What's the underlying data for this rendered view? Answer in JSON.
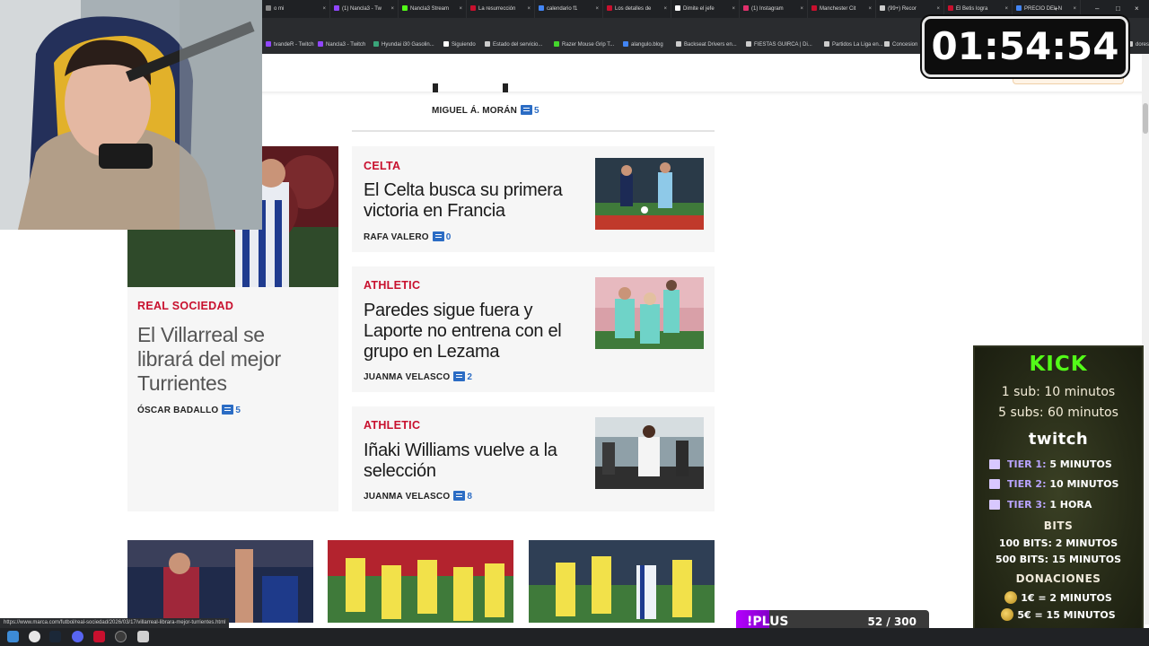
{
  "browser": {
    "tabs": [
      {
        "label": "o mi",
        "color": "#888888"
      },
      {
        "label": "(1) Nancla3 - Tw",
        "color": "#9146ff"
      },
      {
        "label": "Nancla3 Stream",
        "color": "#53fc18"
      },
      {
        "label": "La resurrección",
        "color": "#c8102e"
      },
      {
        "label": "calendario f1",
        "color": "#4285f4"
      },
      {
        "label": "Los detalles de",
        "color": "#c8102e"
      },
      {
        "label": "Dimite el jefe",
        "color": "#ffffff"
      },
      {
        "label": "(1) Instagram",
        "color": "#e1306c"
      },
      {
        "label": "Manchester Cit",
        "color": "#c8102e"
      },
      {
        "label": "(99+) Recor",
        "color": "#cccccc"
      },
      {
        "label": "El Betis logra",
        "color": "#c8102e"
      },
      {
        "label": "PRECIO DEL N",
        "color": "#4285f4"
      }
    ],
    "bookmarks": [
      {
        "label": "tvandeR - Twitch",
        "color": "#9146ff"
      },
      {
        "label": "Nancla3 - Twitch",
        "color": "#9146ff"
      },
      {
        "label": "Hyundai i30 Gasolin...",
        "color": "#3aa57a"
      },
      {
        "label": "Siguiendo",
        "color": "#ffffff"
      },
      {
        "label": "Estado del servicio...",
        "color": "#cccccc"
      },
      {
        "label": "Razer Mouse Grip T...",
        "color": "#44d62c"
      },
      {
        "label": "alangulo.blog",
        "color": "#4285f4"
      },
      {
        "label": "Backseat Drivers en...",
        "color": "#cccccc"
      },
      {
        "label": "FIESTAS GUIRCA | Di...",
        "color": "#cccccc"
      },
      {
        "label": "Partidos La Liga en...",
        "color": "#cccccc"
      },
      {
        "label": "Concesion",
        "color": "#cccccc"
      },
      {
        "label": "dores",
        "color": "#cccccc"
      }
    ],
    "status_url": "https://www.marca.com/futbol/real-sociedad/2026/03/17/villarreal-librara-mejor-turrientes.html"
  },
  "top_article": {
    "author": "MIGUEL Á. MORÁN",
    "comments": "5"
  },
  "feature_article": {
    "section": "REAL SOCIEDAD",
    "headline_lines": [
      "El Villarreal se",
      "librará del mejor",
      "Turrientes"
    ],
    "author": "ÓSCAR BADALLO",
    "comments": "5"
  },
  "articles": [
    {
      "section": "CELTA",
      "headline_lines": [
        "El Celta busca su primera",
        "victoria en Francia"
      ],
      "author": "RAFA VALERO",
      "comments": "0"
    },
    {
      "section": "ATHLETIC",
      "headline_lines": [
        "Paredes sigue fuera y",
        "Laporte no entrena con el",
        "grupo en Lezama"
      ],
      "author": "JUANMA VELASCO",
      "comments": "2"
    },
    {
      "section": "ATHLETIC",
      "headline_lines": [
        "Iñaki Williams vuelve a la",
        "selección"
      ],
      "author": "JUANMA VELASCO",
      "comments": "8"
    }
  ],
  "timer": "01:54:54",
  "subathon": {
    "kick_title": "KICK",
    "kick_lines": [
      "1 sub: 10 minutos",
      "5 subs: 60 minutos"
    ],
    "twitch_title": "twitch",
    "tiers": [
      {
        "tier": "TIER 1:",
        "value": "5 MINUTOS"
      },
      {
        "tier": "TIER 2:",
        "value": "10 MINUTOS"
      },
      {
        "tier": "TIER 3:",
        "value": "1 HORA"
      }
    ],
    "bits_title": "BITS",
    "bits_lines": [
      "100 BITS: 2 MINUTOS",
      "500 BITS: 15 MINUTOS"
    ],
    "donations_title": "DONACIONES",
    "donation_lines": [
      "1€ = 2 MINUTOS",
      "5€ = 15 MINUTOS"
    ]
  },
  "subgoal": {
    "label": "!PLUS",
    "count": "52 / 300",
    "progress": 0.173
  }
}
